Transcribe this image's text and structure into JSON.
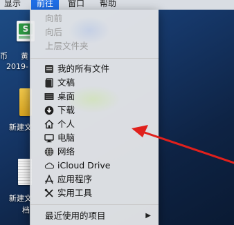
{
  "menubar": {
    "items": [
      "显示",
      "前往",
      "窗口",
      "帮助"
    ],
    "active": "前往"
  },
  "desktop": {
    "items": [
      {
        "label_line1": "黄",
        "label_line2": "2019-",
        "side_text": "币"
      },
      {
        "label": "新建文"
      },
      {
        "label_line1": "新建文",
        "label_line2": "档"
      }
    ]
  },
  "go_menu": {
    "history": [
      "向前",
      "向后",
      "上层文件夹"
    ],
    "places": [
      {
        "label": "我的所有文件",
        "icon": "all-files-icon"
      },
      {
        "label": "文稿",
        "icon": "documents-icon"
      },
      {
        "label": "桌面",
        "icon": "desktop-icon"
      },
      {
        "label": "下载",
        "icon": "downloads-icon"
      },
      {
        "label": "个人",
        "icon": "home-icon"
      },
      {
        "label": "电脑",
        "icon": "computer-icon"
      },
      {
        "label": "网络",
        "icon": "network-icon"
      },
      {
        "label": "iCloud Drive",
        "icon": "cloud-icon"
      },
      {
        "label": "应用程序",
        "icon": "applications-icon"
      },
      {
        "label": "实用工具",
        "icon": "utilities-icon"
      }
    ],
    "recent": {
      "label": "最近使用的项目",
      "arrow": "▶"
    }
  },
  "colors": {
    "menubar_highlight": "#1f6ee6",
    "annotation_arrow": "#e0201c"
  }
}
